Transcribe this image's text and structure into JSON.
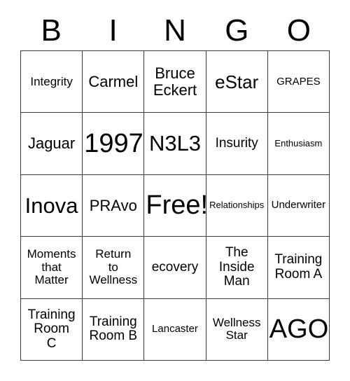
{
  "card": {
    "title": "BINGO",
    "header_letters": [
      "B",
      "I",
      "N",
      "G",
      "O"
    ],
    "colors": {
      "background": "#ffffff",
      "text": "#000000",
      "border": "#3a3a3a"
    },
    "grid": {
      "rows": 5,
      "columns": 5,
      "free_space_index": 12,
      "cells": [
        {
          "text": "Integrity",
          "size": "m"
        },
        {
          "text": "Carmel",
          "size": "l"
        },
        {
          "text": "Bruce\nEckert",
          "size": "l"
        },
        {
          "text": "eStar",
          "size": "xl"
        },
        {
          "text": "GRAPES",
          "size": "s"
        },
        {
          "text": "Jaguar",
          "size": "l"
        },
        {
          "text": "1997",
          "size": "huge"
        },
        {
          "text": "N3L3",
          "size": "xxl"
        },
        {
          "text": "Insurity",
          "size": "ml"
        },
        {
          "text": "Enthusiasm",
          "size": "xs"
        },
        {
          "text": "Inova",
          "size": "xxl"
        },
        {
          "text": "PRAvo",
          "size": "l"
        },
        {
          "text": "Free!",
          "size": "huge"
        },
        {
          "text": "Relationships",
          "size": "xs"
        },
        {
          "text": "Underwriter",
          "size": "s"
        },
        {
          "text": "Moments\nthat\nMatter",
          "size": "m"
        },
        {
          "text": "Return\nto\nWellness",
          "size": "m"
        },
        {
          "text": "ecovery",
          "size": "ml"
        },
        {
          "text": "The\nInside\nMan",
          "size": "ml"
        },
        {
          "text": "Training\nRoom A",
          "size": "ml"
        },
        {
          "text": "Training\nRoom\nC",
          "size": "ml"
        },
        {
          "text": "Training\nRoom B",
          "size": "ml"
        },
        {
          "text": "Lancaster",
          "size": "s"
        },
        {
          "text": "Wellness\nStar",
          "size": "m"
        },
        {
          "text": "AGO",
          "size": "huge"
        }
      ]
    }
  }
}
